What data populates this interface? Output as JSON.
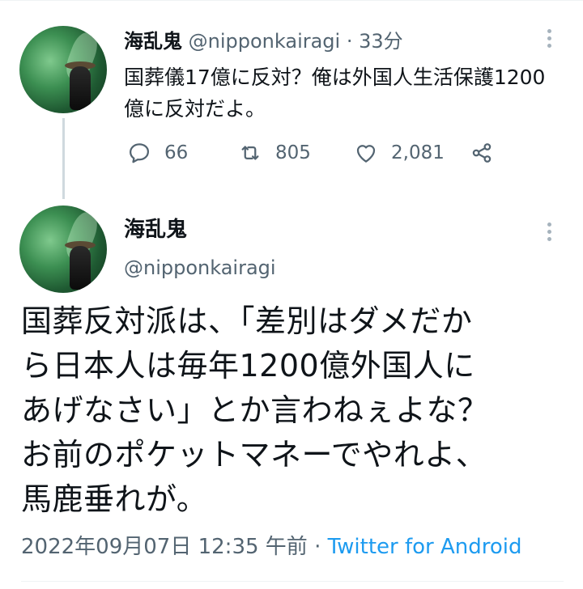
{
  "parent_tweet": {
    "display_name": "海乱鬼",
    "handle": "@nipponkairagi",
    "separator": "·",
    "time": "33分",
    "text": "国葬儀17億に反対？俺は外国人生活保護1200億に反対だよ。",
    "actions": {
      "reply_icon": "reply-icon",
      "reply_count": "66",
      "retweet_icon": "retweet-icon",
      "retweet_count": "805",
      "like_icon": "heart-icon",
      "like_count": "2,081",
      "share_icon": "share-icon"
    }
  },
  "main_tweet": {
    "display_name": "海乱鬼",
    "handle": "@nipponkairagi",
    "text_lines": [
      "国葬反対派は、「差別はダメだか",
      "ら日本人は毎年1200億外国人に",
      "あげなさい」とか言わねぇよな？",
      "お前のポケットマネーでやれよ、",
      "馬鹿垂れが。"
    ],
    "timestamp": "2022年09月07日 12:35 午前",
    "separator": "·",
    "source": "Twitter for Android"
  },
  "colors": {
    "text_primary": "#0f1419",
    "text_secondary": "#536471",
    "link": "#1d9bf0",
    "thread_line": "#cfd9de"
  }
}
